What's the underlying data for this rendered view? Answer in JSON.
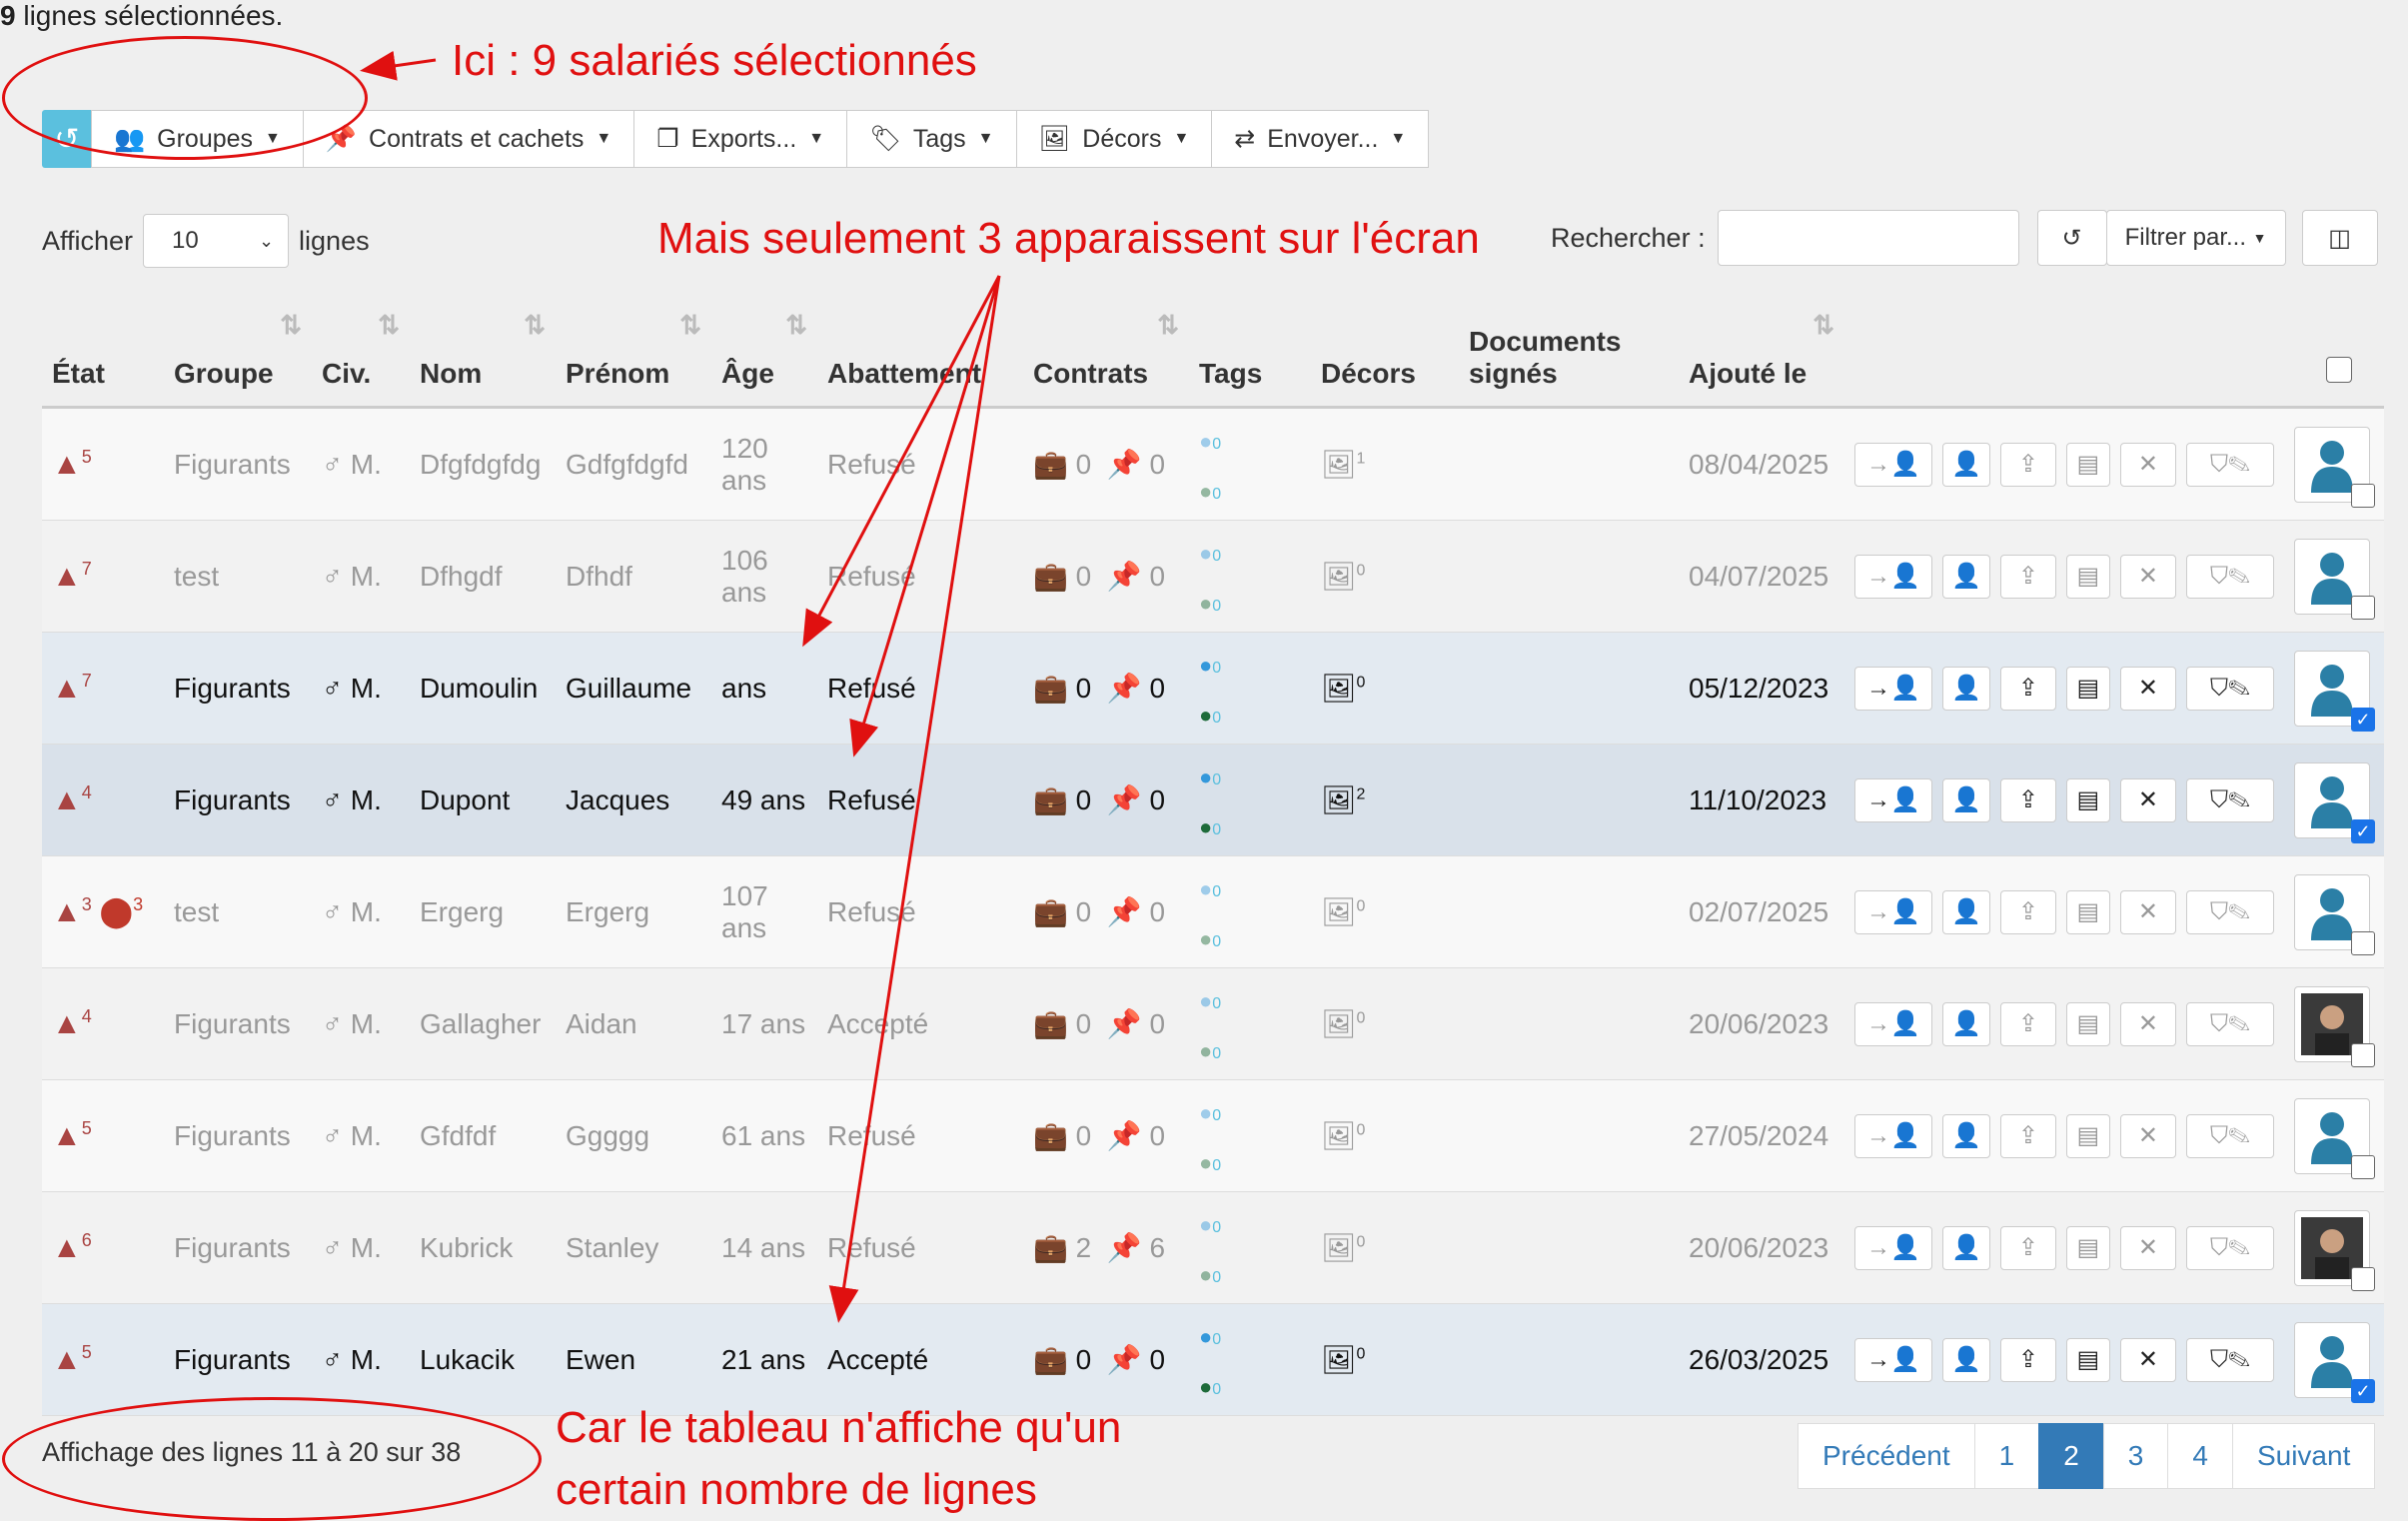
{
  "selection": {
    "count": "9",
    "text": "lignes sélectionnées."
  },
  "toolbar": {
    "undo_icon": "undo-icon",
    "buttons": [
      "Groupes",
      "Contrats et cachets",
      "Exports...",
      "Tags",
      "Décors",
      "Envoyer..."
    ]
  },
  "length": {
    "prefix": "Afficher",
    "value": "10",
    "suffix": "lignes"
  },
  "search": {
    "label": "Rechercher :",
    "value": "",
    "filter": "Filtrer par..."
  },
  "columns": [
    "État",
    "Groupe",
    "Civ.",
    "Nom",
    "Prénom",
    "Âge",
    "Abattement",
    "Contrats",
    "Tags",
    "Décors",
    "Documents signés",
    "Ajouté le"
  ],
  "rows": [
    {
      "etat": "5",
      "etat2": "",
      "groupe": "Figurants",
      "civ": "♂ M.",
      "nom": "Dfgfdgfdg",
      "prenom": "Gdfgfdgfd",
      "age": "120 ans",
      "abattement": "Refusé",
      "contrats": "0",
      "cachets": "0",
      "tag1": "0",
      "tag2": "0",
      "decors": "1",
      "ajoute": "08/04/2025",
      "selected": false,
      "photo": false
    },
    {
      "etat": "7",
      "etat2": "",
      "groupe": "test",
      "civ": "♂ M.",
      "nom": "Dfhgdf",
      "prenom": "Dfhdf",
      "age": "106 ans",
      "abattement": "Refusé",
      "contrats": "0",
      "cachets": "0",
      "tag1": "0",
      "tag2": "0",
      "decors": "0",
      "ajoute": "04/07/2025",
      "selected": false,
      "photo": false
    },
    {
      "etat": "7",
      "etat2": "",
      "groupe": "Figurants",
      "civ": "♂ M.",
      "nom": "Dumoulin",
      "prenom": "Guillaume",
      "age": "ans",
      "abattement": "Refusé",
      "contrats": "0",
      "cachets": "0",
      "tag1": "0",
      "tag2": "0",
      "decors": "0",
      "ajoute": "05/12/2023",
      "selected": true,
      "photo": false
    },
    {
      "etat": "4",
      "etat2": "",
      "groupe": "Figurants",
      "civ": "♂ M.",
      "nom": "Dupont",
      "prenom": "Jacques",
      "age": "49 ans",
      "abattement": "Refusé",
      "contrats": "0",
      "cachets": "0",
      "tag1": "0",
      "tag2": "0",
      "decors": "2",
      "ajoute": "11/10/2023",
      "selected": true,
      "photo": false
    },
    {
      "etat": "3",
      "etat2": "3",
      "groupe": "test",
      "civ": "♂ M.",
      "nom": "Ergerg",
      "prenom": "Ergerg",
      "age": "107 ans",
      "abattement": "Refusé",
      "contrats": "0",
      "cachets": "0",
      "tag1": "0",
      "tag2": "0",
      "decors": "0",
      "ajoute": "02/07/2025",
      "selected": false,
      "photo": false
    },
    {
      "etat": "4",
      "etat2": "",
      "groupe": "Figurants",
      "civ": "♂ M.",
      "nom": "Gallagher",
      "prenom": "Aidan",
      "age": "17 ans",
      "abattement": "Accepté",
      "contrats": "0",
      "cachets": "0",
      "tag1": "0",
      "tag2": "0",
      "decors": "0",
      "ajoute": "20/06/2023",
      "selected": false,
      "photo": true
    },
    {
      "etat": "5",
      "etat2": "",
      "groupe": "Figurants",
      "civ": "♂ M.",
      "nom": "Gfdfdf",
      "prenom": "Ggggg",
      "age": "61 ans",
      "abattement": "Refusé",
      "contrats": "0",
      "cachets": "0",
      "tag1": "0",
      "tag2": "0",
      "decors": "0",
      "ajoute": "27/05/2024",
      "selected": false,
      "photo": false
    },
    {
      "etat": "6",
      "etat2": "",
      "groupe": "Figurants",
      "civ": "♂ M.",
      "nom": "Kubrick",
      "prenom": "Stanley",
      "age": "14 ans",
      "abattement": "Refusé",
      "contrats": "2",
      "cachets": "6",
      "tag1": "0",
      "tag2": "0",
      "decors": "0",
      "ajoute": "20/06/2023",
      "selected": false,
      "photo": true
    },
    {
      "etat": "5",
      "etat2": "",
      "groupe": "Figurants",
      "civ": "♂ M.",
      "nom": "Lukacik",
      "prenom": "Ewen",
      "age": "21 ans",
      "abattement": "Accepté",
      "contrats": "0",
      "cachets": "0",
      "tag1": "0",
      "tag2": "0",
      "decors": "0",
      "ajoute": "26/03/2025",
      "selected": true,
      "photo": false
    }
  ],
  "info": "Affichage des lignes 11 à 20 sur 38",
  "pagination": [
    "Précédent",
    "1",
    "2",
    "3",
    "4",
    "Suivant"
  ],
  "pagination_active": "2",
  "annotations": {
    "top": "Ici : 9 salariés sélectionnés",
    "middle": "Mais seulement 3 apparaissent sur l'écran",
    "bottom_line1": "Car le tableau n'affiche qu'un",
    "bottom_line2": "certain nombre de lignes"
  },
  "colors": {
    "annotation": "#e01010",
    "primary": "#337ab7",
    "info": "#5bc0de",
    "warning": "#a94442"
  }
}
